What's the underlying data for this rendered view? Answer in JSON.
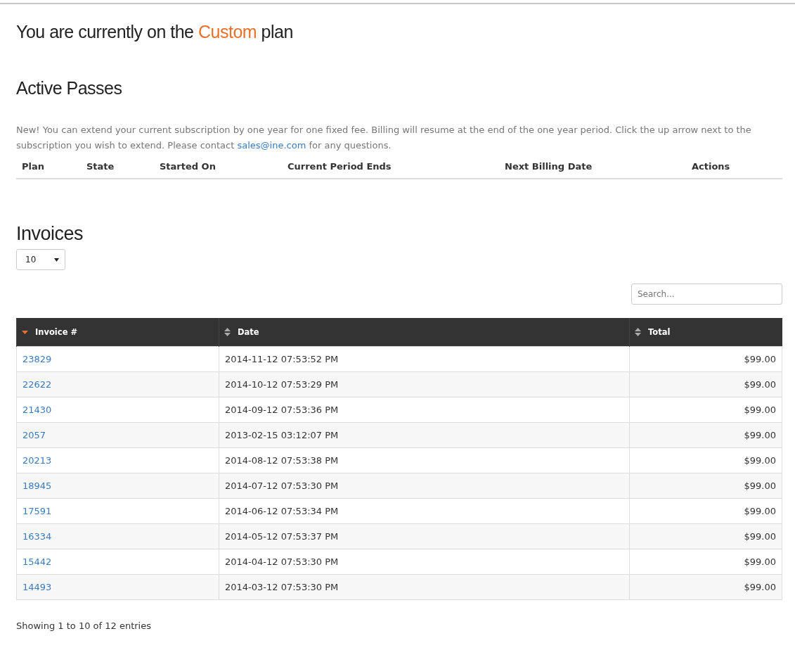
{
  "plan_heading": {
    "before": "You are currently on the",
    "plan": "Custom",
    "after": "plan"
  },
  "active_passes": {
    "title": "Active Passes",
    "notice": {
      "before": "New! You can extend your current subscription by one year for one fixed fee. Billing will resume at the end of the one year period. Click the up arrow next to the subscription you wish to extend. Please contact",
      "link": "sales@ine.com",
      "after": "for any questions."
    },
    "columns": [
      "Plan",
      "State",
      "Started On",
      "Current Period Ends",
      "Next Billing Date",
      "Actions"
    ]
  },
  "invoices": {
    "title": "Invoices",
    "page_size": "10",
    "search": {
      "placeholder": "Search..."
    },
    "columns": [
      {
        "label": "Invoice #",
        "sorted": true
      },
      {
        "label": "Date",
        "sorted": false
      },
      {
        "label": "Total",
        "sorted": false
      }
    ],
    "rows": [
      {
        "invoice": "23829",
        "date": "2014-11-12 07:53:52 PM",
        "total": "$99.00"
      },
      {
        "invoice": "22622",
        "date": "2014-10-12 07:53:29 PM",
        "total": "$99.00"
      },
      {
        "invoice": "21430",
        "date": "2014-09-12 07:53:36 PM",
        "total": "$99.00"
      },
      {
        "invoice": "2057",
        "date": "2013-02-15 03:12:07 PM",
        "total": "$99.00"
      },
      {
        "invoice": "20213",
        "date": "2014-08-12 07:53:38 PM",
        "total": "$99.00"
      },
      {
        "invoice": "18945",
        "date": "2014-07-12 07:53:30 PM",
        "total": "$99.00"
      },
      {
        "invoice": "17591",
        "date": "2014-06-12 07:53:34 PM",
        "total": "$99.00"
      },
      {
        "invoice": "16334",
        "date": "2014-05-12 07:53:37 PM",
        "total": "$99.00"
      },
      {
        "invoice": "15442",
        "date": "2014-04-12 07:53:30 PM",
        "total": "$99.00"
      },
      {
        "invoice": "14493",
        "date": "2014-03-12 07:53:30 PM",
        "total": "$99.00"
      }
    ],
    "summary": "Showing 1 to 10 of 12 entries"
  }
}
